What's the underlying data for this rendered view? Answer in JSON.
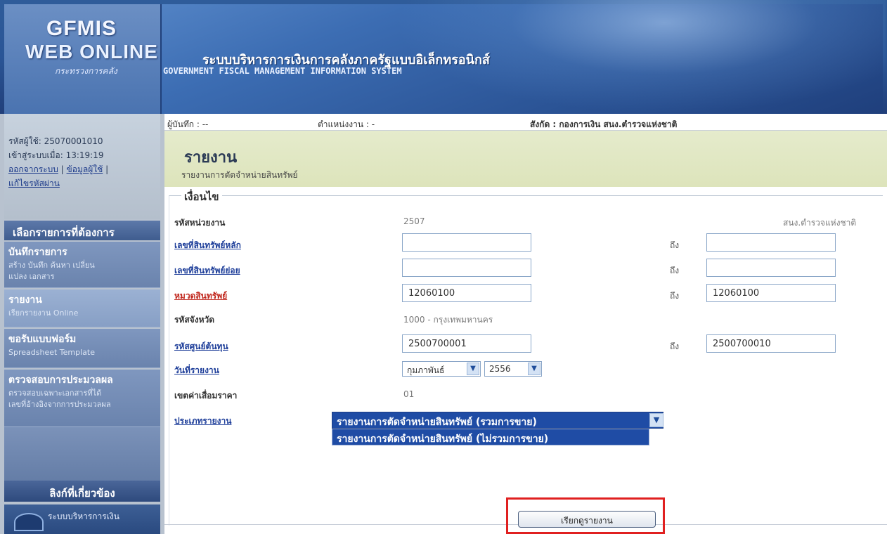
{
  "header": {
    "logo_line1": "GFMIS",
    "logo_line2": "WEB ONLINE",
    "logo_line3": "กระทรวงการคลัง",
    "title_th": "ระบบบริหารการเงินการคลังภาครัฐแบบอิเล็กทรอนิกส์",
    "title_en": "GOVERNMENT FISCAL MANAGEMENT INFORMATION SYSTEM"
  },
  "user_info": {
    "user_code": "รหัสผู้ใช้: 25070001010",
    "login_time": "เข้าสู่ระบบเมื่อ: 13:19:19",
    "logout_link": "ออกจากระบบ",
    "profile_link": "ข้อมูลผู้ใช้",
    "change_password_link": "แก้ไขรหัสผ่าน"
  },
  "menu": {
    "heading": "เลือกรายการที่ต้องการ",
    "items": [
      {
        "title": "บันทึกรายการ",
        "sub1": "สร้าง บันทึก ค้นหา เปลี่ยน",
        "sub2": "แปลง เอกสาร"
      },
      {
        "title": "รายงาน",
        "sub1": "เรียกรายงาน Online",
        "sub2": ""
      },
      {
        "title": "ขอรับแบบฟอร์ม",
        "sub1": "Spreadsheet Template",
        "sub2": ""
      },
      {
        "title": "ตรวจสอบการประมวลผล",
        "sub1": "ตรวจสอบเฉพาะเอกสารที่ได้",
        "sub2": "เลขที่อ้างอิงจากการประมวลผล"
      }
    ],
    "related_heading": "ลิงก์ที่เกี่ยวข้อง",
    "related_link": "ระบบบริหารการเงิน"
  },
  "info_bar": {
    "recorder": "ผู้บันทึก : --",
    "position": "ตำแหน่งงาน : -",
    "affiliation": "สังกัด : กองการเงิน สนง.ตำรวจแห่งชาติ"
  },
  "page": {
    "title": "รายงาน",
    "subtitle": "รายงานการตัดจำหน่ายสินทรัพย์",
    "conditions_label": "เงื่อนไข"
  },
  "form": {
    "agency_code_label": "รหัสหน่วยงาน",
    "agency_code_value": "2507",
    "agency_name": "สนง.ตำรวจแห่งชาติ",
    "main_asset_label": "เลขที่สินทรัพย์หลัก",
    "main_asset_from": "",
    "main_asset_to": "",
    "sub_asset_label": "เลขที่สินทรัพย์ย่อย",
    "sub_asset_from": "",
    "sub_asset_to": "",
    "asset_category_label": "หมวดสินทรัพย์",
    "asset_category_from": "12060100",
    "asset_category_to": "12060100",
    "province_label": "รหัสจังหวัด",
    "province_value": "1000 - กรุงเทพมหานคร",
    "cost_center_label": "รหัสศูนย์ต้นทุน",
    "cost_center_from": "2500700001",
    "cost_center_to": "2500700010",
    "report_date_label": "วันที่รายงาน",
    "report_month": "กุมภาพันธ์",
    "report_year": "2556",
    "depreciation_area_label": "เขตค่าเสื่อมราคา",
    "depreciation_area_value": "01",
    "report_type_label": "ประเภทรายงาน",
    "report_type_selected": "รายงานการตัดจำหน่ายสินทรัพย์ (รวมการขาย)",
    "report_type_option": "รายงานการตัดจำหน่ายสินทรัพย์ (ไม่รวมการขาย)",
    "to_label": "ถึง"
  },
  "actions": {
    "report_button": "เรียกดูรายงาน"
  }
}
